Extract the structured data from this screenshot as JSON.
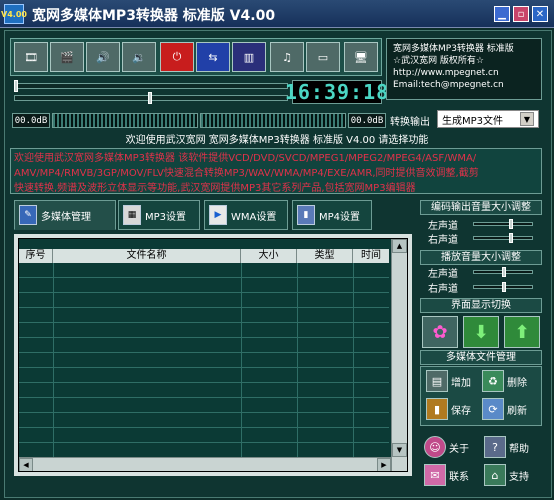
{
  "window": {
    "title": "宽网多媒体MP3转换器 标准版 V4.00",
    "logo_text": "V4.00"
  },
  "toolbar": {
    "buttons": [
      {
        "name": "add-media-icon"
      },
      {
        "name": "batch-media-icon"
      },
      {
        "name": "speaker-icon"
      },
      {
        "name": "speaker-settings-icon"
      },
      {
        "name": "power-icon"
      },
      {
        "name": "convert-icon"
      },
      {
        "name": "equalizer-icon"
      },
      {
        "name": "music-notes-icon"
      },
      {
        "name": "card-icon"
      },
      {
        "name": "monitor-icon"
      }
    ]
  },
  "clock": {
    "time": "16:39:18"
  },
  "info": {
    "line1": "宽网多媒体MP3转换器 标准版",
    "line2": "☆武汉宽网 版权所有☆",
    "line3": "http://www.mpegnet.cn",
    "line4": "Email:tech@mpegnet.cn"
  },
  "levels": {
    "left_db": "00.0dB",
    "right_db": "00.0dB"
  },
  "output": {
    "label": "转换输出",
    "selected": "生成MP3文件"
  },
  "welcome": "欢迎使用武汉宽网 宽网多媒体MP3转换器 标准版 V4.00 请选择功能",
  "marquee": {
    "line1": "欢迎使用武汉宽网多媒体MP3转换器 该软件提供VCD/DVD/SVCD/MPEG1/MPEG2/MPEG4/ASF/WMA/",
    "line2": "AMV/MP4/RMVB/3GP/MOV/FLV快速混合转换MP3/WAV/WMA/MP4/EXE/AMR,同时提供音效调整,截剪",
    "line3": "快速转换,频谱及波形立体显示等功能,武汉宽网提供MP3其它系列产品,包括宽网MP3编辑器"
  },
  "tabs": [
    {
      "label": "多媒体管理",
      "icon": "media-manage-icon"
    },
    {
      "label": "MP3设置",
      "icon": "mp3-settings-icon"
    },
    {
      "label": "WMA设置",
      "icon": "wma-settings-icon"
    },
    {
      "label": "MP4设置",
      "icon": "mp4-settings-icon"
    }
  ],
  "table": {
    "columns": [
      "序号",
      "文件名称",
      "大小",
      "类型",
      "时间"
    ]
  },
  "right_panel": {
    "encode_volume": {
      "title": "编码输出音量大小调整",
      "left": "左声道",
      "right": "右声道",
      "left_level": 0.62,
      "right_level": 0.62
    },
    "play_volume": {
      "title": "播放音量大小调整",
      "left": "左声道",
      "right": "右声道",
      "left_level": 0.5,
      "right_level": 0.5
    },
    "display_switch": {
      "title": "界面显示切换"
    },
    "file_manage": {
      "title": "多媒体文件管理",
      "add": "增加",
      "delete": "删除",
      "save": "保存",
      "refresh": "刷新"
    },
    "bottom": {
      "about": "关于",
      "help": "帮助",
      "contact": "联系",
      "support": "支持"
    }
  },
  "colors": {
    "frame": "#0f3531",
    "accent": "#4bd6c4",
    "marquee_text": "#e0324a"
  }
}
